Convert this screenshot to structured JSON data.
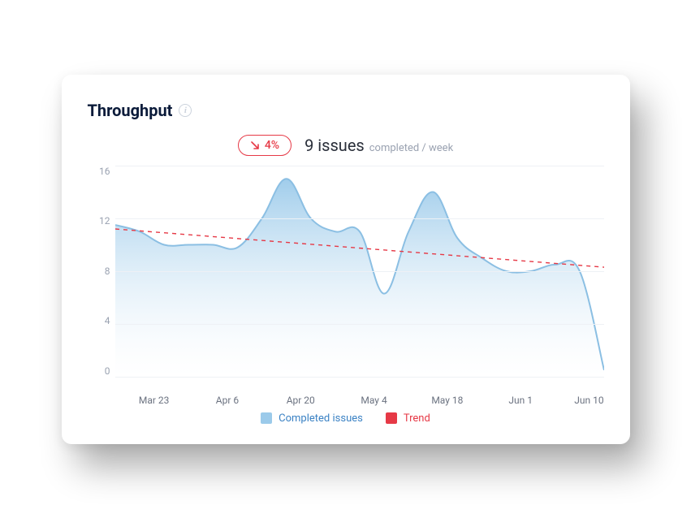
{
  "card": {
    "title": "Throughput",
    "badge_delta": "4%",
    "metric_value": "9 issues",
    "metric_suffix": "completed / week"
  },
  "legend": {
    "series_label": "Completed issues",
    "trend_label": "Trend"
  },
  "chart_data": {
    "type": "area",
    "xlabel": "",
    "ylabel": "",
    "ylim": [
      0,
      16
    ],
    "y_ticks": [
      16,
      12,
      8,
      4,
      0
    ],
    "x_ticks": [
      "Mar 23",
      "Apr 6",
      "Apr 20",
      "May 4",
      "May 18",
      "Jun 1",
      "Jun 10"
    ],
    "x_tick_positions": [
      0.08,
      0.23,
      0.38,
      0.53,
      0.68,
      0.83,
      0.97
    ],
    "series": [
      {
        "name": "Completed issues",
        "color": "#9bcaea",
        "x": [
          0.0,
          0.05,
          0.1,
          0.15,
          0.2,
          0.25,
          0.3,
          0.35,
          0.4,
          0.45,
          0.5,
          0.55,
          0.6,
          0.65,
          0.7,
          0.75,
          0.8,
          0.85,
          0.9,
          0.95,
          1.0
        ],
        "values": [
          11.5,
          11.0,
          10.0,
          10.0,
          10.0,
          9.8,
          12.0,
          15.0,
          12.0,
          11.0,
          11.0,
          6.3,
          11.0,
          14.0,
          10.5,
          9.0,
          8.0,
          8.0,
          8.5,
          8.0,
          0.5
        ]
      },
      {
        "name": "Trend",
        "color": "#e63946",
        "type": "line",
        "dashed": true,
        "x": [
          0.0,
          1.0
        ],
        "values": [
          11.2,
          8.3
        ]
      }
    ]
  }
}
